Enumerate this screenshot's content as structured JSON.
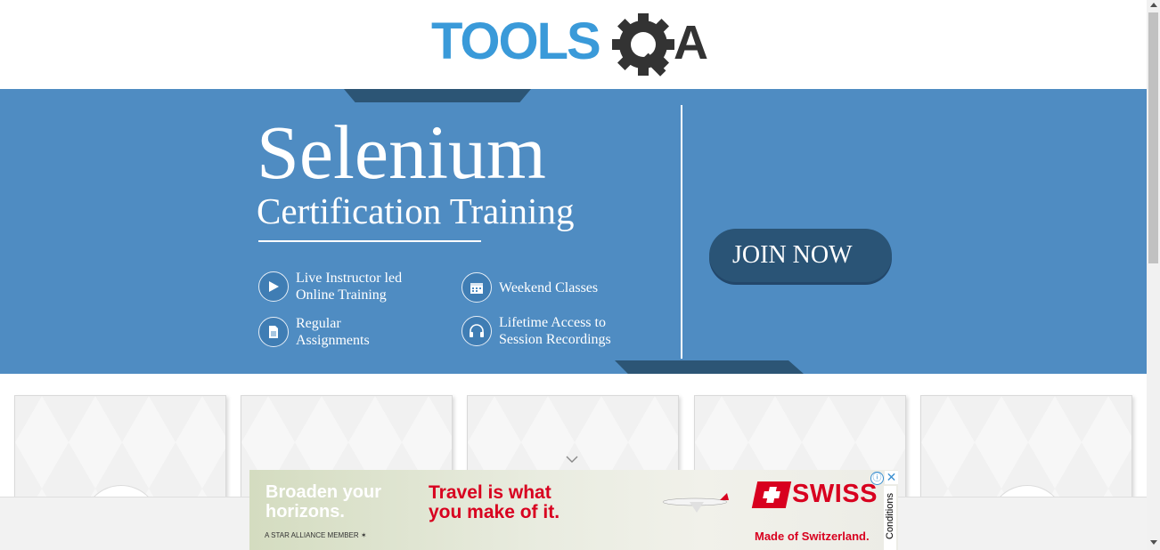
{
  "header": {
    "logo_text_main": "TOOLS",
    "logo_text_accent": "A",
    "logo_icon": "gear-magnifier-icon",
    "brand_color": "#3a9ad9",
    "dark_color": "#333333"
  },
  "banner": {
    "title": "Selenium",
    "subtitle": "Certification Training",
    "background_color": "#4f8cc2",
    "features": [
      {
        "icon": "play-icon",
        "label": "Live Instructor led\nOnline Training"
      },
      {
        "icon": "calendar-icon",
        "label": "Weekend Classes"
      },
      {
        "icon": "document-icon",
        "label": "Regular\nAssignments"
      },
      {
        "icon": "headphones-icon",
        "label": "Lifetime Access to\nSession Recordings"
      }
    ],
    "cta_label": "JOIN NOW",
    "cta_color": "#2a5476"
  },
  "cards": {
    "count": 5
  },
  "ad": {
    "headline_left": "Broaden your\nhorizons.",
    "tagline_small": "A STAR ALLIANCE MEMBER",
    "headline_center": "Travel is what\nyou make of it.",
    "brand": "SWISS",
    "slogan": "Made of Switzerland.",
    "conditions": "Conditions",
    "info_glyph": "ⓘ",
    "close_glyph": "✕",
    "accent_color": "#d8001f"
  }
}
